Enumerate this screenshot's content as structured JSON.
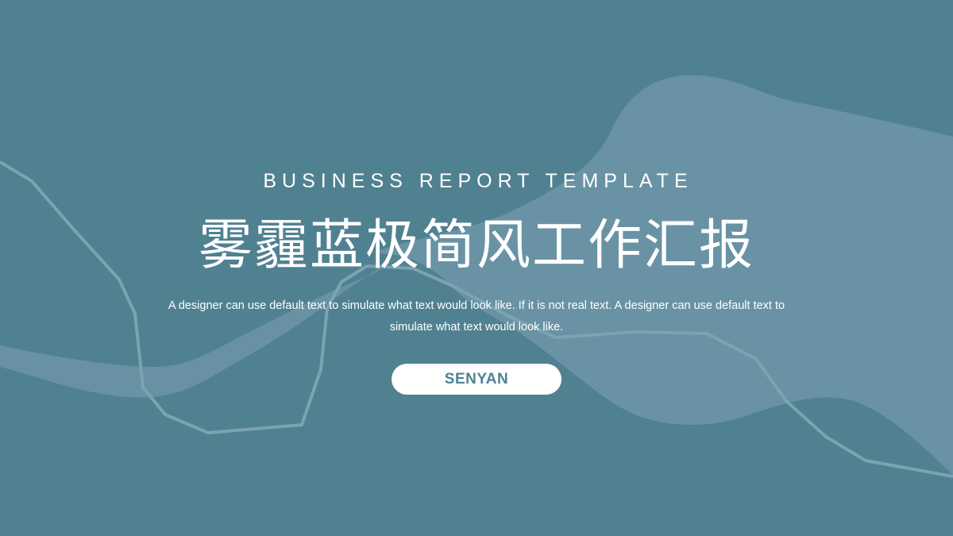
{
  "slide": {
    "subtitle": "BUSINESS REPORT TEMPLATE",
    "title": "雾霾蓝极简风工作汇报",
    "description": "A designer can use default text to simulate what text would look like. If it is not real text. A designer can use default text to simulate what text would look like.",
    "author_button_label": "SENYAN"
  },
  "colors": {
    "background": "#508191",
    "shape_light": "#6a93a6",
    "line": "#7aa3b4",
    "text": "#ffffff",
    "button_text": "#4f8293"
  }
}
